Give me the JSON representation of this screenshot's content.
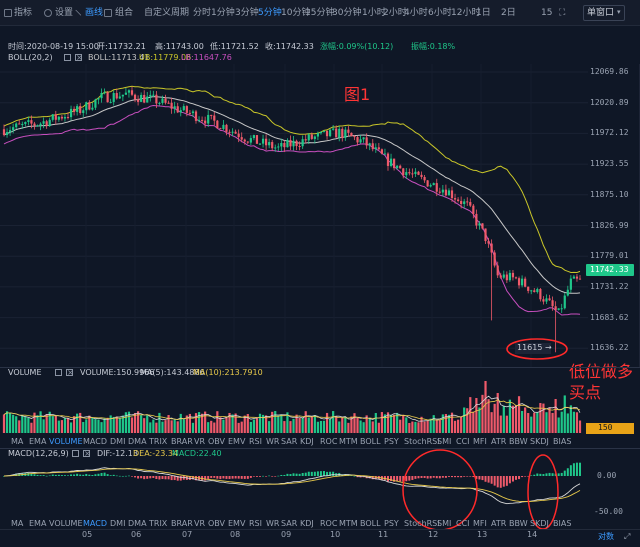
{
  "toolbar": {
    "indicator_btn": "指标",
    "settings_btn": "设置",
    "draw_btn": "画线",
    "combo_btn": "组合",
    "custom_period": "自定义周期",
    "periods": [
      "分时",
      "1分钟",
      "3分钟",
      "5分钟",
      "10分钟",
      "15分钟",
      "30分钟",
      "1小时",
      "2小时",
      "4小时",
      "6小时",
      "12小时",
      "1日",
      "2日"
    ],
    "active_period": "5分钟",
    "right_text": "15",
    "chart_mode": "单窗口"
  },
  "info_bar": {
    "time": "时间:2020-08-19 15:00",
    "open": "开:11732.21",
    "high": "高:11743.00",
    "low": "低:11721.52",
    "close": "收:11742.33",
    "change": "涨幅:0.09%(10.12)",
    "amplitude": "振幅:0.18%"
  },
  "boll_legend": {
    "name": "BOLL(20,2)",
    "mid": "BOLL:11713.41",
    "ub": "UB:11779.06",
    "lb": "LB:11647.76"
  },
  "price_axis": [
    "12069.86",
    "12020.89",
    "11972.12",
    "11923.55",
    "11875.10",
    "11826.99",
    "11779.01",
    "11731.22",
    "11683.62",
    "11636.22"
  ],
  "last_price": "11742.33",
  "low_marker": "11615 →",
  "annotations": {
    "fig_label": "图1",
    "buy_note_line1": "低位做多",
    "buy_note_line2": "买点"
  },
  "volume_legend": {
    "name": "VOLUME",
    "value": "VOLUME:150.9966",
    "ma5": "MA(5):143.4886",
    "ma10": "MA(10):213.7910"
  },
  "volume_axis_label": "150",
  "macd_legend": {
    "name": "MACD(12,26,9)",
    "dif": "DIF:-12.13",
    "dea": "DEA:-23.34",
    "macd": "MACD:22.40"
  },
  "macd_axis": [
    "0.00",
    "-50.00"
  ],
  "indicator_tabs_1": [
    "MA",
    "EMA",
    "VOLUME",
    "MACD",
    "DMI",
    "DMA",
    "TRIX",
    "BRAR",
    "VR",
    "OBV",
    "EMV",
    "RSI",
    "WR",
    "SAR",
    "KDJ",
    "ROC",
    "MTM",
    "BOLL",
    "PSY",
    "StochRSI",
    "SMI",
    "CCI",
    "MFI",
    "ATR",
    "BBW",
    "SKDJ",
    "BIAS"
  ],
  "indicator_tabs_1_selected": "VOLUME",
  "indicator_tabs_2": [
    "MA",
    "EMA",
    "VOLUME",
    "MACD",
    "DMI",
    "DMA",
    "TRIX",
    "BRAR",
    "VR",
    "OBV",
    "EMV",
    "RSI",
    "WR",
    "SAR",
    "KDJ",
    "ROC",
    "MTM",
    "BOLL",
    "PSY",
    "StochRSI",
    "SMI",
    "CCI",
    "MFI",
    "ATR",
    "BBW",
    "SKDJ",
    "BIAS"
  ],
  "indicator_tabs_2_selected": "MACD",
  "x_axis_days": [
    "05",
    "06",
    "07",
    "08",
    "09",
    "10",
    "11",
    "12",
    "13",
    "14"
  ],
  "footer_right": "对数",
  "colors": {
    "up": "#1fc78a",
    "down": "#ef5a6a",
    "boll_ub": "#c9c629",
    "boll_mid": "#c7c7c7",
    "boll_lb": "#c84fbf",
    "accent": "#3d9bff",
    "annotation": "#ff3535",
    "bg": "#0f1726"
  }
}
